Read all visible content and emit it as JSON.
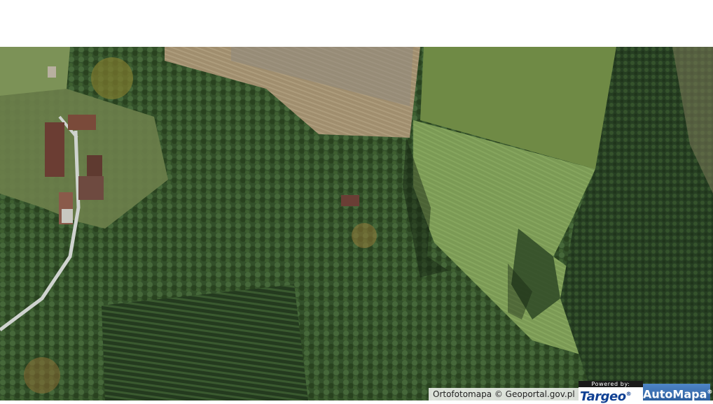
{
  "map": {
    "type": "orthophoto-aerial",
    "attribution": "Ortofotomapa © Geoportal.gov.pl",
    "powered_by": "Powered by:",
    "logo_targeo": "Targeo",
    "logo_automapa": "AutoMapa",
    "registered_mark": "®"
  },
  "colors": {
    "forest": "#2f4a24",
    "field_green": "#7d9a52",
    "field_brown": "#9c8a6a",
    "road": "#cfd3cf",
    "roof": "#7a4a3a",
    "accent_targeo": "#0e3f93",
    "accent_automapa": "#2c5e9e"
  }
}
